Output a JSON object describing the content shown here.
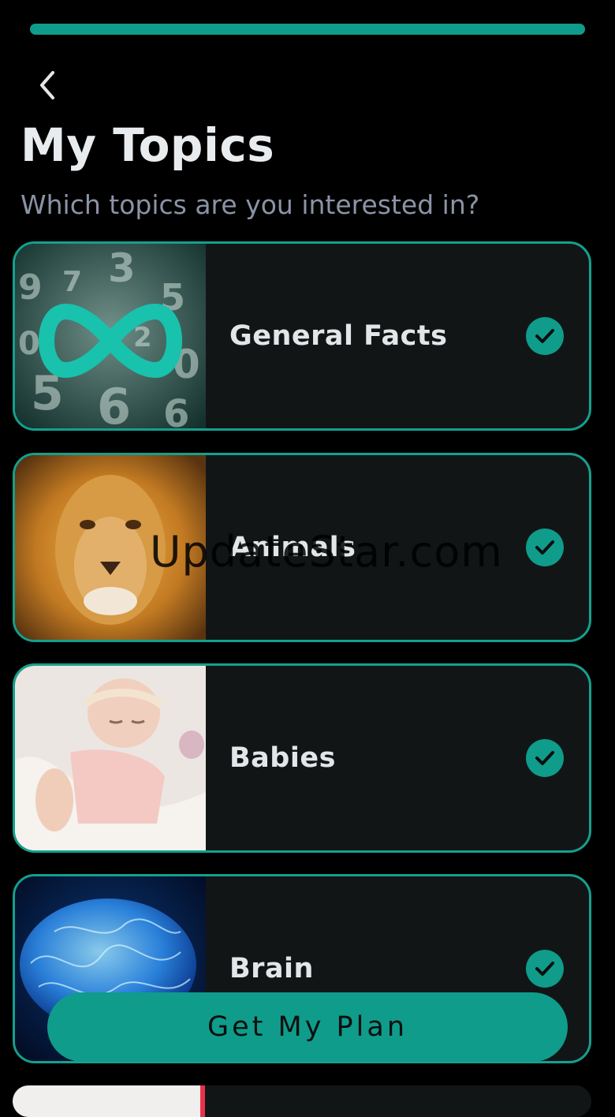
{
  "progress": 1.0,
  "header": {
    "back_icon": "chevron-left-icon",
    "title": "My Topics",
    "subtitle": "Which topics are you interested in?"
  },
  "topics": [
    {
      "label": "General Facts",
      "checked": true,
      "image": "numbers-infinity-image"
    },
    {
      "label": "Animals",
      "checked": true,
      "image": "lion-image"
    },
    {
      "label": "Babies",
      "checked": true,
      "image": "sleeping-baby-image"
    },
    {
      "label": "Brain",
      "checked": true,
      "image": "glowing-brain-image"
    }
  ],
  "watermark": "UpdateStar.com",
  "cta": {
    "label": "Get My Plan"
  },
  "colors": {
    "accent": "#0f9c8a",
    "background": "#000000",
    "card": "#121516"
  }
}
